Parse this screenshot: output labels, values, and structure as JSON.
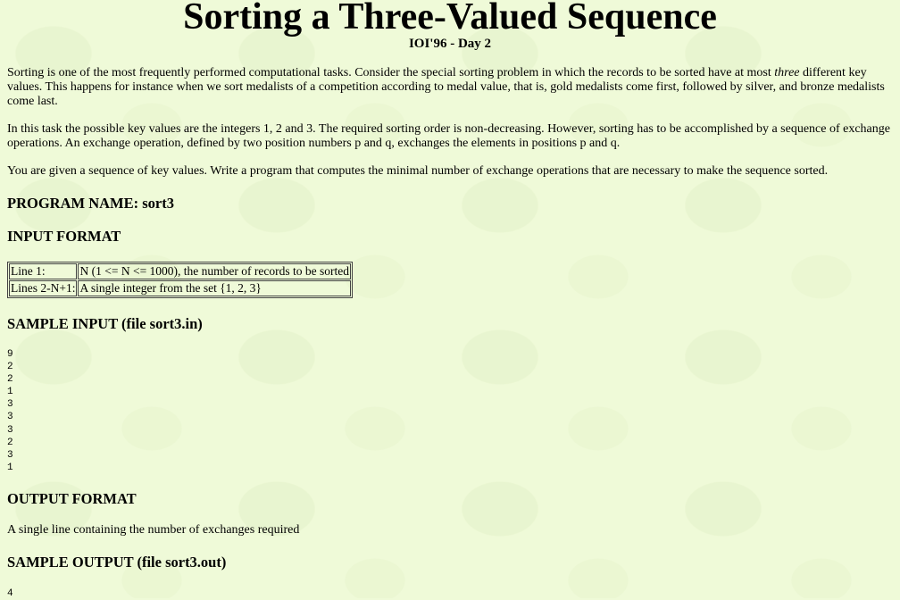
{
  "title": "Sorting a Three-Valued Sequence",
  "subtitle": "IOI'96 - Day 2",
  "intro": {
    "p1_before": "Sorting is one of the most frequently performed computational tasks. Consider the special sorting problem in which the records to be sorted have at most ",
    "p1_em": "three",
    "p1_after": " different key values. This happens for instance when we sort medalists of a competition according to medal value, that is, gold medalists come first, followed by silver, and bronze medalists come last.",
    "p2": "In this task the possible key values are the integers 1, 2 and 3. The required sorting order is non-decreasing. However, sorting has to be accomplished by a sequence of exchange operations. An exchange operation, defined by two position numbers p and q, exchanges the elements in positions p and q.",
    "p3": "You are given a sequence of key values. Write a program that computes the minimal number of exchange operations that are necessary to make the sequence sorted."
  },
  "program_name_heading": "PROGRAM NAME: sort3",
  "input_format": {
    "heading": "INPUT FORMAT",
    "rows": [
      {
        "line": "Line 1:",
        "desc": "N (1 <= N <= 1000), the number of records to be sorted"
      },
      {
        "line": "Lines 2-N+1:",
        "desc": "A single integer from the set {1, 2, 3}"
      }
    ]
  },
  "sample_input": {
    "heading": "SAMPLE INPUT (file sort3.in)",
    "content": "9\n2\n2\n1\n3\n3\n3\n2\n3\n1"
  },
  "output_format": {
    "heading": "OUTPUT FORMAT",
    "text": "A single line containing the number of exchanges required"
  },
  "sample_output": {
    "heading": "SAMPLE OUTPUT (file sort3.out)",
    "content": "4"
  }
}
